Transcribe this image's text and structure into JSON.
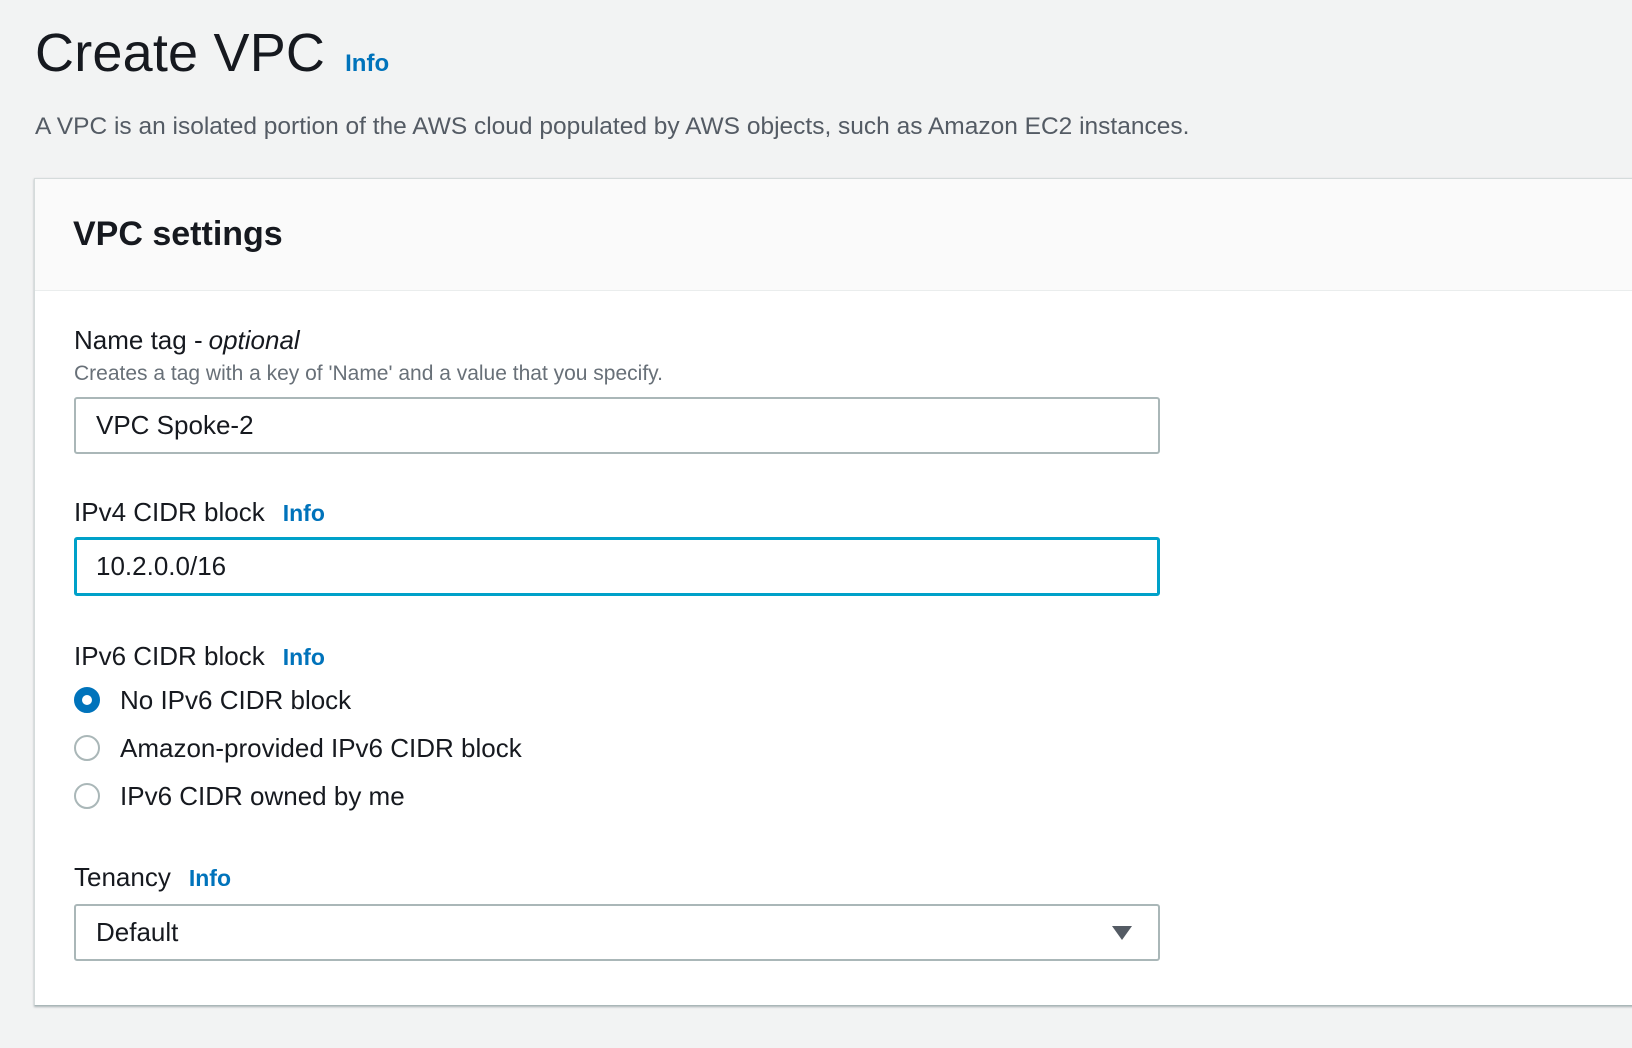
{
  "page": {
    "title": "Create VPC",
    "info_label": "Info",
    "description": "A VPC is an isolated portion of the AWS cloud populated by AWS objects, such as Amazon EC2 instances."
  },
  "panel": {
    "title": "VPC settings"
  },
  "name_tag": {
    "label": "Name tag - ",
    "label_optional": "optional",
    "description": "Creates a tag with a key of 'Name' and a value that you specify.",
    "value": "VPC Spoke-2"
  },
  "ipv4": {
    "label": "IPv4 CIDR block",
    "info_label": "Info",
    "value": "10.2.0.0/16"
  },
  "ipv6": {
    "label": "IPv6 CIDR block",
    "info_label": "Info",
    "options": [
      {
        "label": "No IPv6 CIDR block",
        "checked": true
      },
      {
        "label": "Amazon-provided IPv6 CIDR block",
        "checked": false
      },
      {
        "label": "IPv6 CIDR owned by me",
        "checked": false
      }
    ]
  },
  "tenancy": {
    "label": "Tenancy",
    "info_label": "Info",
    "selected": "Default"
  },
  "colors": {
    "link": "#0073bb",
    "focus_border": "#00a1c9",
    "radio_selected": "#0073bb"
  }
}
